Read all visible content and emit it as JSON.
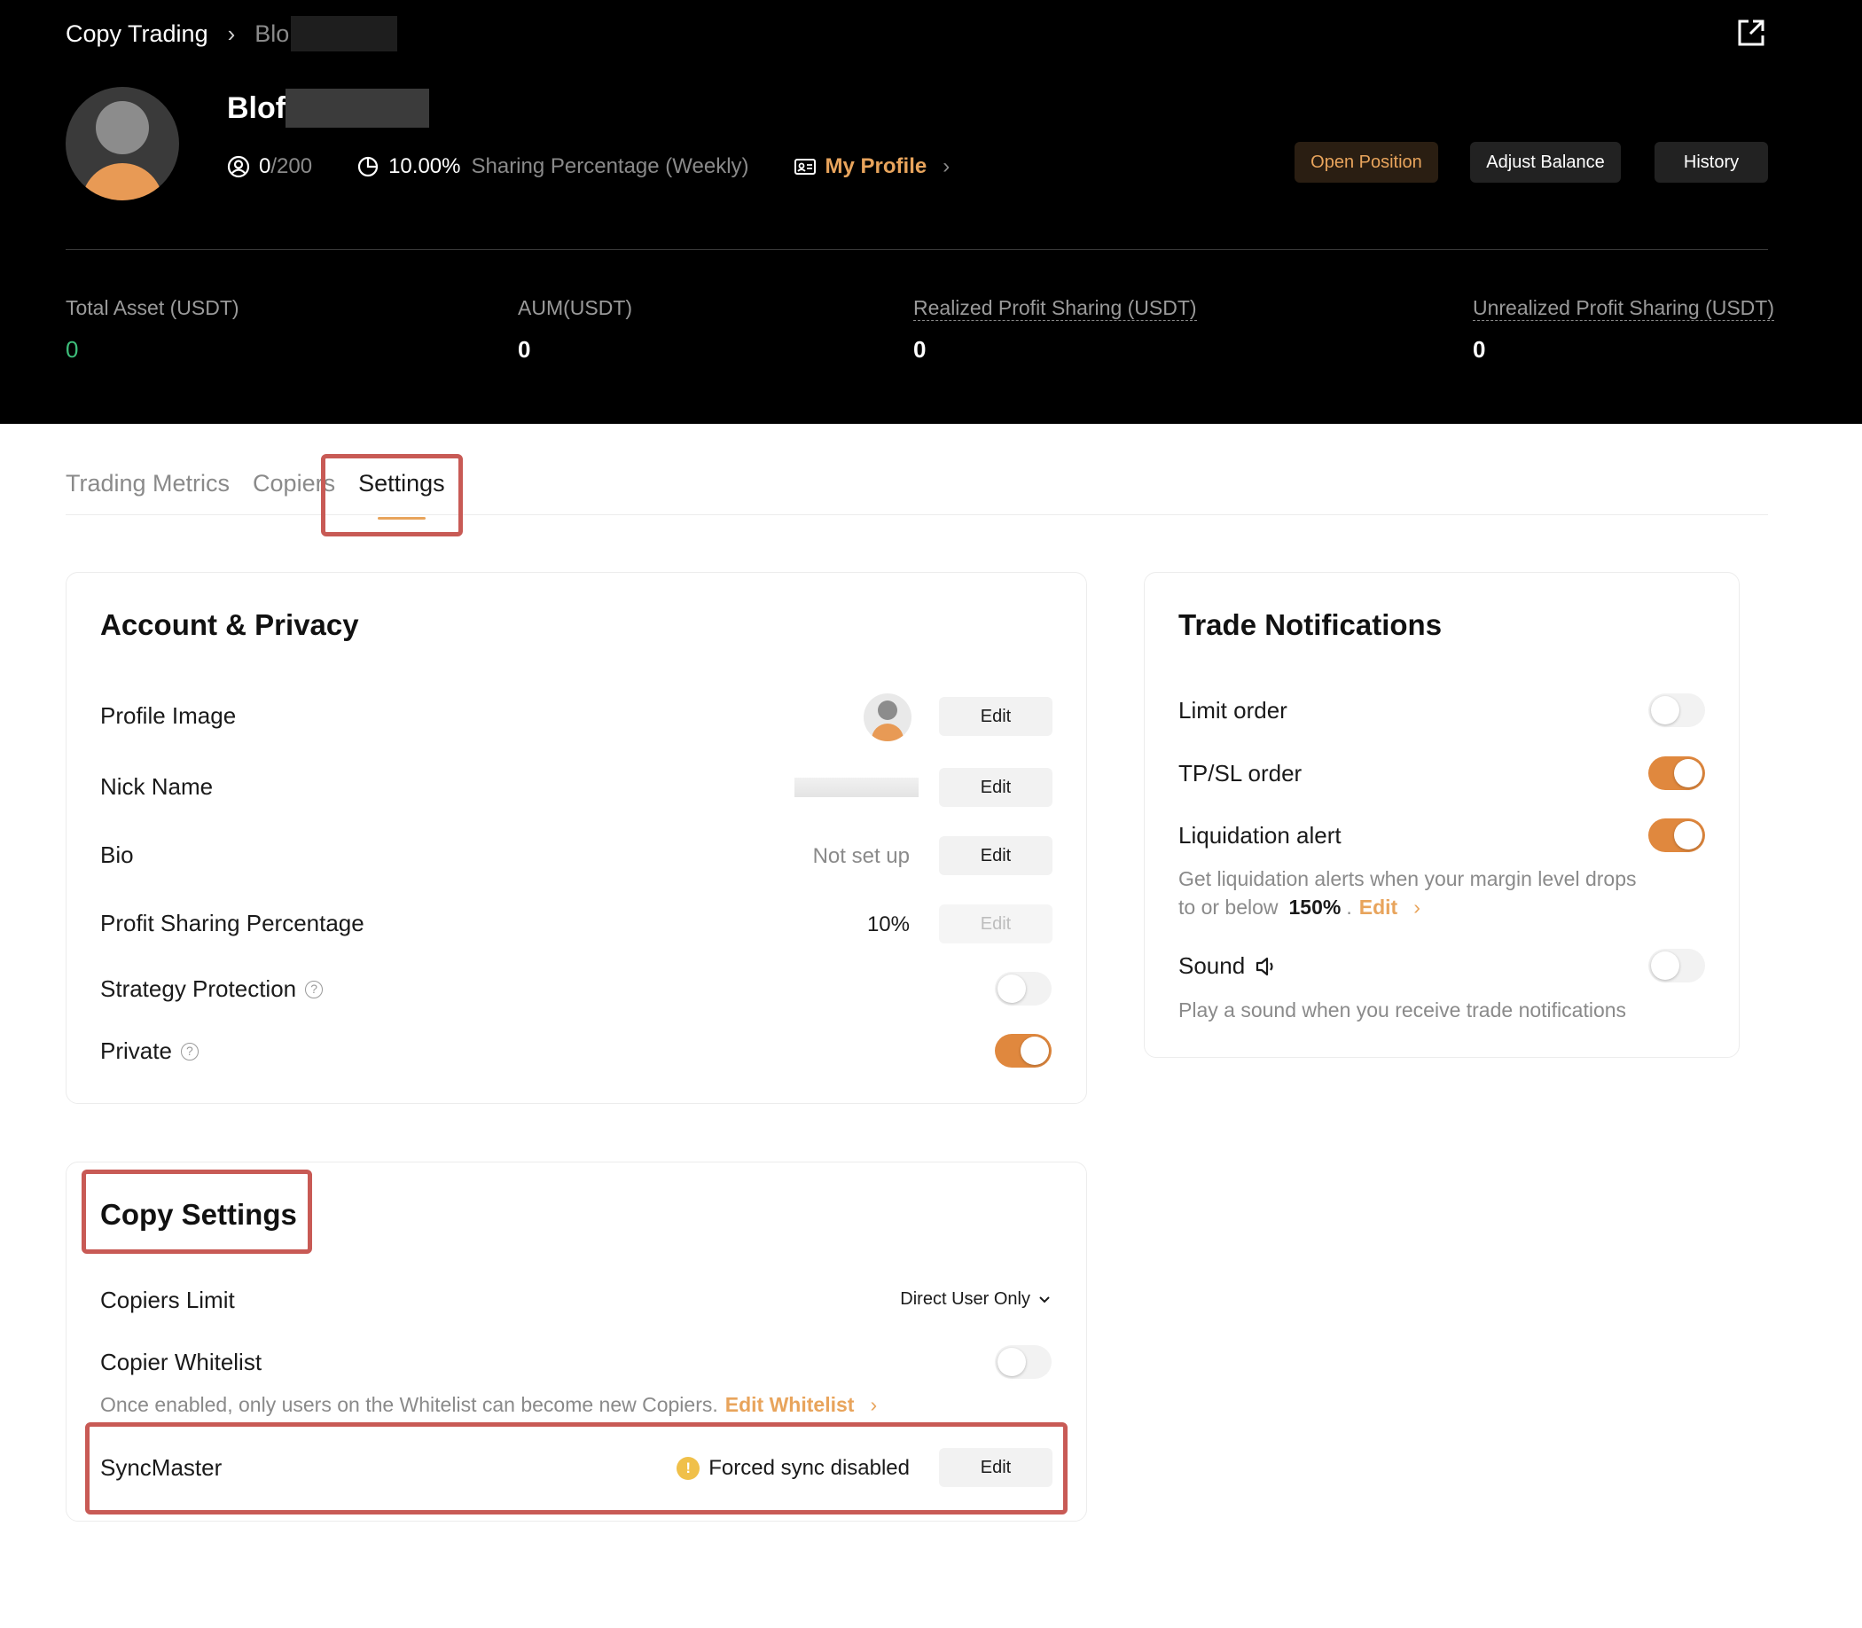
{
  "breadcrumb": {
    "root": "Copy Trading",
    "current": "Blo"
  },
  "trader": {
    "name": "Blof",
    "copiers_current": "0",
    "copiers_max": "/200",
    "sharing_value": "10.00%",
    "sharing_label": "Sharing Percentage (Weekly)",
    "my_profile": "My Profile"
  },
  "actions": {
    "open_position": "Open Position",
    "adjust_balance": "Adjust Balance",
    "history": "History"
  },
  "metrics": [
    {
      "label": "Total Asset (USDT)",
      "value": "0"
    },
    {
      "label": "AUM(USDT)",
      "value": "0"
    },
    {
      "label": "Realized Profit Sharing (USDT)",
      "value": "0"
    },
    {
      "label": "Unrealized Profit Sharing (USDT)",
      "value": "0"
    }
  ],
  "tabs": [
    {
      "label": "Trading Metrics"
    },
    {
      "label": "Copiers"
    },
    {
      "label": "Settings",
      "active": true
    }
  ],
  "account_privacy": {
    "title": "Account & Privacy",
    "edit_label": "Edit",
    "profile_image": "Profile Image",
    "nick_name": "Nick Name",
    "bio": "Bio",
    "bio_value": "Not set up",
    "profit_sharing": "Profit Sharing Percentage",
    "profit_sharing_value": "10%",
    "strategy_protection": "Strategy Protection",
    "strategy_protection_on": false,
    "private": "Private",
    "private_on": true
  },
  "copy_settings": {
    "title": "Copy Settings",
    "copiers_limit": "Copiers Limit",
    "copiers_limit_value": "Direct User Only",
    "copier_whitelist": "Copier Whitelist",
    "copier_whitelist_on": false,
    "whitelist_desc": "Once enabled, only users on the Whitelist can become new Copiers.",
    "edit_whitelist": "Edit Whitelist",
    "syncmaster": "SyncMaster",
    "syncmaster_status": "Forced sync disabled",
    "edit_label": "Edit"
  },
  "trade_notifications": {
    "title": "Trade Notifications",
    "limit_order": "Limit order",
    "limit_order_on": false,
    "tpsl_order": "TP/SL order",
    "tpsl_order_on": true,
    "liquidation_alert": "Liquidation alert",
    "liquidation_alert_on": true,
    "liquidation_desc_1": "Get liquidation alerts when your margin level drops",
    "liquidation_desc_2": "to or below",
    "liquidation_level": "150%",
    "liquidation_dot": ".",
    "liquidation_edit": "Edit",
    "sound": "Sound",
    "sound_on": false,
    "sound_desc": "Play a sound when you receive trade notifications"
  },
  "colors": {
    "accent": "#e0883e",
    "highlight_box": "#c85a55",
    "positive": "#3dbe7a"
  }
}
